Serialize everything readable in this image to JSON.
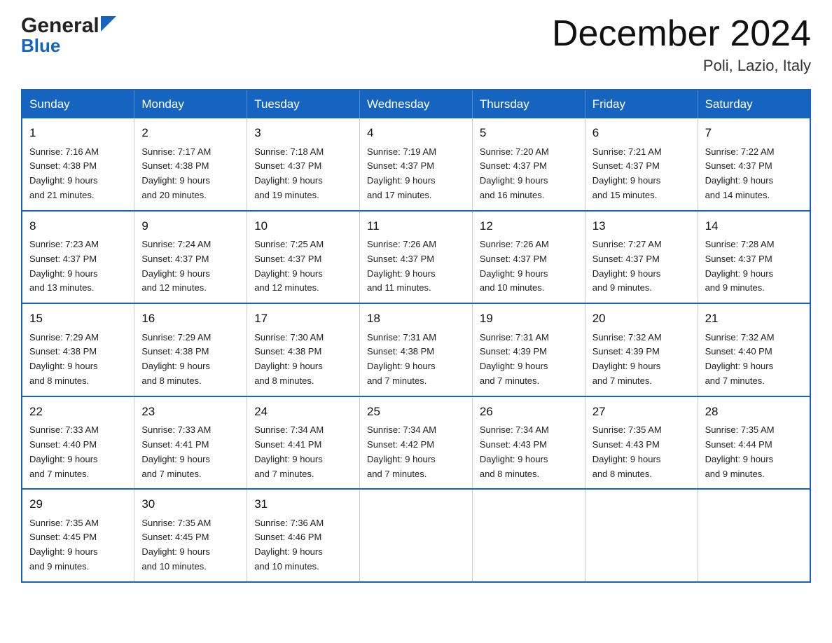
{
  "header": {
    "logo_general": "General",
    "logo_blue": "Blue",
    "month_title": "December 2024",
    "location": "Poli, Lazio, Italy"
  },
  "days_of_week": [
    "Sunday",
    "Monday",
    "Tuesday",
    "Wednesday",
    "Thursday",
    "Friday",
    "Saturday"
  ],
  "weeks": [
    [
      {
        "day": "1",
        "sunrise": "7:16 AM",
        "sunset": "4:38 PM",
        "daylight": "9 hours and 21 minutes."
      },
      {
        "day": "2",
        "sunrise": "7:17 AM",
        "sunset": "4:38 PM",
        "daylight": "9 hours and 20 minutes."
      },
      {
        "day": "3",
        "sunrise": "7:18 AM",
        "sunset": "4:37 PM",
        "daylight": "9 hours and 19 minutes."
      },
      {
        "day": "4",
        "sunrise": "7:19 AM",
        "sunset": "4:37 PM",
        "daylight": "9 hours and 17 minutes."
      },
      {
        "day": "5",
        "sunrise": "7:20 AM",
        "sunset": "4:37 PM",
        "daylight": "9 hours and 16 minutes."
      },
      {
        "day": "6",
        "sunrise": "7:21 AM",
        "sunset": "4:37 PM",
        "daylight": "9 hours and 15 minutes."
      },
      {
        "day": "7",
        "sunrise": "7:22 AM",
        "sunset": "4:37 PM",
        "daylight": "9 hours and 14 minutes."
      }
    ],
    [
      {
        "day": "8",
        "sunrise": "7:23 AM",
        "sunset": "4:37 PM",
        "daylight": "9 hours and 13 minutes."
      },
      {
        "day": "9",
        "sunrise": "7:24 AM",
        "sunset": "4:37 PM",
        "daylight": "9 hours and 12 minutes."
      },
      {
        "day": "10",
        "sunrise": "7:25 AM",
        "sunset": "4:37 PM",
        "daylight": "9 hours and 12 minutes."
      },
      {
        "day": "11",
        "sunrise": "7:26 AM",
        "sunset": "4:37 PM",
        "daylight": "9 hours and 11 minutes."
      },
      {
        "day": "12",
        "sunrise": "7:26 AM",
        "sunset": "4:37 PM",
        "daylight": "9 hours and 10 minutes."
      },
      {
        "day": "13",
        "sunrise": "7:27 AM",
        "sunset": "4:37 PM",
        "daylight": "9 hours and 9 minutes."
      },
      {
        "day": "14",
        "sunrise": "7:28 AM",
        "sunset": "4:37 PM",
        "daylight": "9 hours and 9 minutes."
      }
    ],
    [
      {
        "day": "15",
        "sunrise": "7:29 AM",
        "sunset": "4:38 PM",
        "daylight": "9 hours and 8 minutes."
      },
      {
        "day": "16",
        "sunrise": "7:29 AM",
        "sunset": "4:38 PM",
        "daylight": "9 hours and 8 minutes."
      },
      {
        "day": "17",
        "sunrise": "7:30 AM",
        "sunset": "4:38 PM",
        "daylight": "9 hours and 8 minutes."
      },
      {
        "day": "18",
        "sunrise": "7:31 AM",
        "sunset": "4:38 PM",
        "daylight": "9 hours and 7 minutes."
      },
      {
        "day": "19",
        "sunrise": "7:31 AM",
        "sunset": "4:39 PM",
        "daylight": "9 hours and 7 minutes."
      },
      {
        "day": "20",
        "sunrise": "7:32 AM",
        "sunset": "4:39 PM",
        "daylight": "9 hours and 7 minutes."
      },
      {
        "day": "21",
        "sunrise": "7:32 AM",
        "sunset": "4:40 PM",
        "daylight": "9 hours and 7 minutes."
      }
    ],
    [
      {
        "day": "22",
        "sunrise": "7:33 AM",
        "sunset": "4:40 PM",
        "daylight": "9 hours and 7 minutes."
      },
      {
        "day": "23",
        "sunrise": "7:33 AM",
        "sunset": "4:41 PM",
        "daylight": "9 hours and 7 minutes."
      },
      {
        "day": "24",
        "sunrise": "7:34 AM",
        "sunset": "4:41 PM",
        "daylight": "9 hours and 7 minutes."
      },
      {
        "day": "25",
        "sunrise": "7:34 AM",
        "sunset": "4:42 PM",
        "daylight": "9 hours and 7 minutes."
      },
      {
        "day": "26",
        "sunrise": "7:34 AM",
        "sunset": "4:43 PM",
        "daylight": "9 hours and 8 minutes."
      },
      {
        "day": "27",
        "sunrise": "7:35 AM",
        "sunset": "4:43 PM",
        "daylight": "9 hours and 8 minutes."
      },
      {
        "day": "28",
        "sunrise": "7:35 AM",
        "sunset": "4:44 PM",
        "daylight": "9 hours and 9 minutes."
      }
    ],
    [
      {
        "day": "29",
        "sunrise": "7:35 AM",
        "sunset": "4:45 PM",
        "daylight": "9 hours and 9 minutes."
      },
      {
        "day": "30",
        "sunrise": "7:35 AM",
        "sunset": "4:45 PM",
        "daylight": "9 hours and 10 minutes."
      },
      {
        "day": "31",
        "sunrise": "7:36 AM",
        "sunset": "4:46 PM",
        "daylight": "9 hours and 10 minutes."
      },
      null,
      null,
      null,
      null
    ]
  ],
  "labels": {
    "sunrise": "Sunrise:",
    "sunset": "Sunset:",
    "daylight": "Daylight:"
  }
}
